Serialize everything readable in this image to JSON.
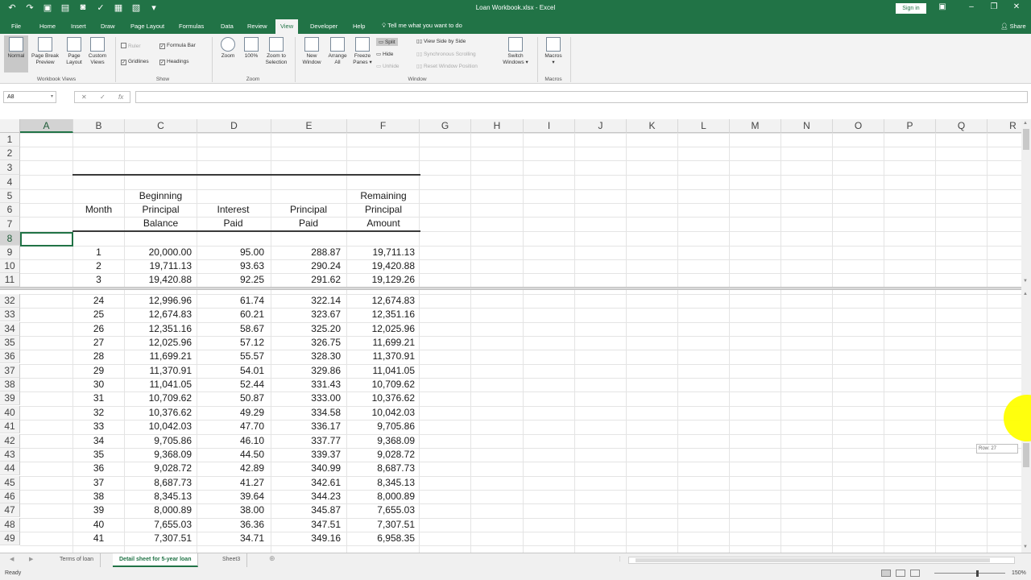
{
  "titlebar": {
    "title": "Loan Workbook.xlsx  -  Excel",
    "signin": "Sign in",
    "window_buttons": [
      "–",
      "❐",
      "✕"
    ],
    "display_options_icon": "▣"
  },
  "tabs": {
    "file": "File",
    "home": "Home",
    "insert": "Insert",
    "draw": "Draw",
    "page_layout": "Page Layout",
    "formulas": "Formulas",
    "data": "Data",
    "review": "Review",
    "view": "View",
    "developer": "Developer",
    "help": "Help",
    "tell_me": "Tell me what you want to do",
    "share": "Share"
  },
  "ribbon": {
    "workbook_views": {
      "label": "Workbook Views",
      "normal": "Normal",
      "page_break_1": "Page Break",
      "page_break_2": "Preview",
      "page_layout_1": "Page",
      "page_layout_2": "Layout",
      "custom_1": "Custom",
      "custom_2": "Views"
    },
    "show": {
      "label": "Show",
      "ruler": "Ruler",
      "formula_bar": "Formula Bar",
      "gridlines": "Gridlines",
      "headings": "Headings"
    },
    "zoom": {
      "label": "Zoom",
      "zoom": "Zoom",
      "hundred": "100%",
      "sel_1": "Zoom to",
      "sel_2": "Selection"
    },
    "window": {
      "label": "Window",
      "new_1": "New",
      "new_2": "Window",
      "arrange_1": "Arrange",
      "arrange_2": "All",
      "freeze_1": "Freeze",
      "freeze_2": "Panes ▾",
      "split": "Split",
      "hide": "Hide",
      "unhide": "Unhide",
      "side_by_side": "View Side by Side",
      "sync_scroll": "Synchronous Scrolling",
      "reset_pos": "Reset Window Position",
      "switch_1": "Switch",
      "switch_2": "Windows ▾"
    },
    "macros": {
      "label": "Macros",
      "macros": "Macros",
      "arrow": "▾"
    }
  },
  "formula_bar": {
    "name_box": "A8",
    "name_box_arrow": "▾",
    "cancel": "✕",
    "enter": "✓",
    "fx": "fx",
    "value": ""
  },
  "columns": [
    "A",
    "B",
    "C",
    "D",
    "E",
    "F",
    "G",
    "H",
    "I",
    "J",
    "K",
    "L",
    "M",
    "N",
    "O",
    "P",
    "Q",
    "R"
  ],
  "table": {
    "header_rows": [
      "5",
      "6",
      "7"
    ],
    "headers": {
      "month": "Month",
      "beginning_1": "Beginning",
      "beginning_2": "Principal",
      "beginning_3": "Balance",
      "interest_1": "Interest",
      "interest_2": "Paid",
      "principal_1": "Principal",
      "principal_2": "Paid",
      "remaining_1": "Remaining",
      "remaining_2": "Principal",
      "remaining_3": "Amount"
    },
    "top_rows": [
      {
        "row": "9",
        "month": "1",
        "begin": "20,000.00",
        "interest": "95.00",
        "principal": "288.87",
        "remaining": "19,711.13"
      },
      {
        "row": "10",
        "month": "2",
        "begin": "19,711.13",
        "interest": "93.63",
        "principal": "290.24",
        "remaining": "19,420.88"
      },
      {
        "row": "11",
        "month": "3",
        "begin": "19,420.88",
        "interest": "92.25",
        "principal": "291.62",
        "remaining": "19,129.26"
      }
    ],
    "bottom_rows": [
      {
        "row": "32",
        "month": "24",
        "begin": "12,996.96",
        "interest": "61.74",
        "principal": "322.14",
        "remaining": "12,674.83"
      },
      {
        "row": "33",
        "month": "25",
        "begin": "12,674.83",
        "interest": "60.21",
        "principal": "323.67",
        "remaining": "12,351.16"
      },
      {
        "row": "34",
        "month": "26",
        "begin": "12,351.16",
        "interest": "58.67",
        "principal": "325.20",
        "remaining": "12,025.96"
      },
      {
        "row": "35",
        "month": "27",
        "begin": "12,025.96",
        "interest": "57.12",
        "principal": "326.75",
        "remaining": "11,699.21"
      },
      {
        "row": "36",
        "month": "28",
        "begin": "11,699.21",
        "interest": "55.57",
        "principal": "328.30",
        "remaining": "11,370.91"
      },
      {
        "row": "37",
        "month": "29",
        "begin": "11,370.91",
        "interest": "54.01",
        "principal": "329.86",
        "remaining": "11,041.05"
      },
      {
        "row": "38",
        "month": "30",
        "begin": "11,041.05",
        "interest": "52.44",
        "principal": "331.43",
        "remaining": "10,709.62"
      },
      {
        "row": "39",
        "month": "31",
        "begin": "10,709.62",
        "interest": "50.87",
        "principal": "333.00",
        "remaining": "10,376.62"
      },
      {
        "row": "40",
        "month": "32",
        "begin": "10,376.62",
        "interest": "49.29",
        "principal": "334.58",
        "remaining": "10,042.03"
      },
      {
        "row": "41",
        "month": "33",
        "begin": "10,042.03",
        "interest": "47.70",
        "principal": "336.17",
        "remaining": "9,705.86"
      },
      {
        "row": "42",
        "month": "34",
        "begin": "9,705.86",
        "interest": "46.10",
        "principal": "337.77",
        "remaining": "9,368.09"
      },
      {
        "row": "43",
        "month": "35",
        "begin": "9,368.09",
        "interest": "44.50",
        "principal": "339.37",
        "remaining": "9,028.72"
      },
      {
        "row": "44",
        "month": "36",
        "begin": "9,028.72",
        "interest": "42.89",
        "principal": "340.99",
        "remaining": "8,687.73"
      },
      {
        "row": "45",
        "month": "37",
        "begin": "8,687.73",
        "interest": "41.27",
        "principal": "342.61",
        "remaining": "8,345.13"
      },
      {
        "row": "46",
        "month": "38",
        "begin": "8,345.13",
        "interest": "39.64",
        "principal": "344.23",
        "remaining": "8,000.89"
      },
      {
        "row": "47",
        "month": "39",
        "begin": "8,000.89",
        "interest": "38.00",
        "principal": "345.87",
        "remaining": "7,655.03"
      },
      {
        "row": "48",
        "month": "40",
        "begin": "7,655.03",
        "interest": "36.36",
        "principal": "347.51",
        "remaining": "7,307.51"
      },
      {
        "row": "49",
        "month": "41",
        "begin": "7,307.51",
        "interest": "34.71",
        "principal": "349.16",
        "remaining": "6,958.35"
      }
    ],
    "empty_rows": [
      "1",
      "2",
      "3",
      "4",
      "8"
    ]
  },
  "tooltip": "Row: 27",
  "sheet_tabs": [
    "Terms of loan",
    "Detail sheet for 5-year loan",
    "Sheet3"
  ],
  "sheet_nav": {
    "prev": "◀",
    "next": "▶",
    "add": "⊕",
    "more": "⋮"
  },
  "status": {
    "ready": "Ready",
    "zoom": "150%"
  }
}
